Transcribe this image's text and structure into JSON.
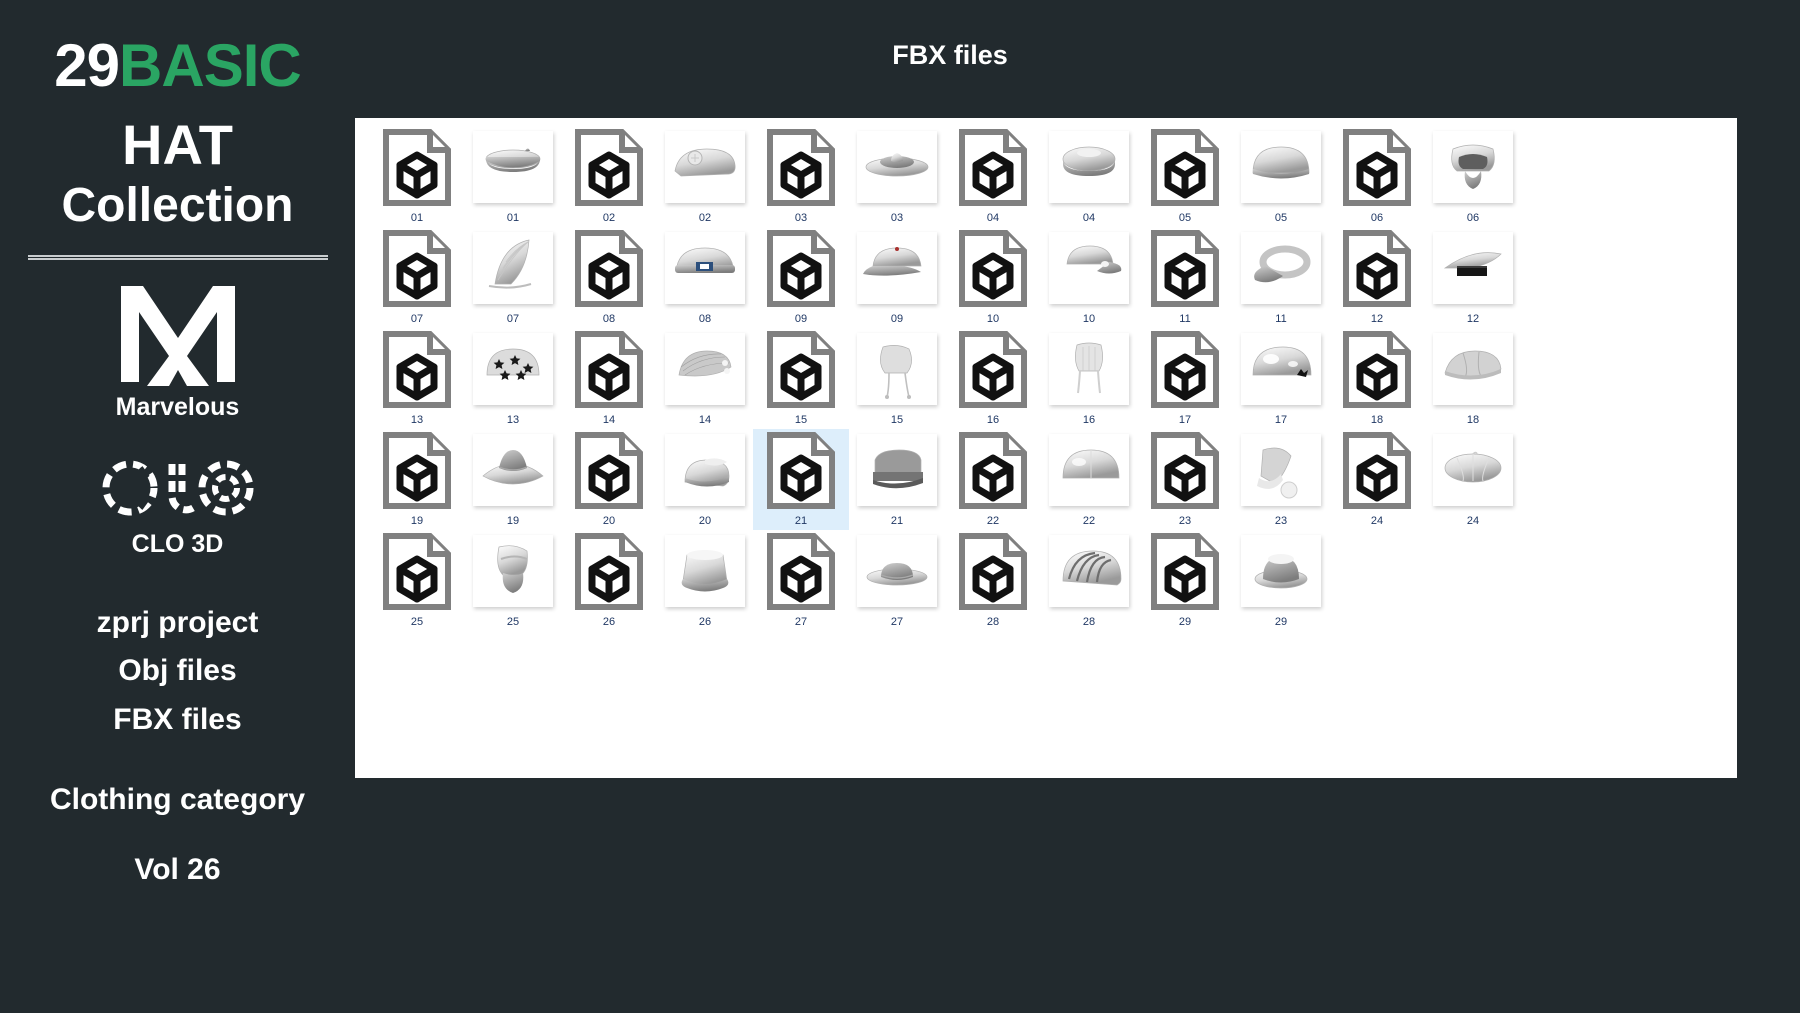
{
  "brand": {
    "count": "29",
    "basic": "BASIC",
    "hat": "HAT",
    "collection": "Collection",
    "marvelous_name": "Marvelous",
    "marvelous_logo_icon": "marvelous-designer-m-logo",
    "clo_name": "CLO 3D",
    "clo_logo_icon": "clo3d-dashed-circles-logo",
    "accent_color": "#2aa563",
    "background_color": "#222a2e",
    "text_color": "#ffffff"
  },
  "files_list": [
    "zprj project",
    "Obj files",
    "FBX files"
  ],
  "category": {
    "label": "Clothing category",
    "volume": "Vol 26"
  },
  "header": {
    "title": "FBX files"
  },
  "panel": {
    "background_color": "#ffffff",
    "selected_index": 21,
    "selection_color": "#ddeefb",
    "label_color": "#203864",
    "file_icon_name": "fbx-3d-cube-file-icon",
    "items": [
      {
        "num": "01",
        "hat": "pillbox-fur-hat"
      },
      {
        "num": "02",
        "hat": "garrison-cap-with-button"
      },
      {
        "num": "03",
        "hat": "flat-wide-brim-hat"
      },
      {
        "num": "04",
        "hat": "baker-boy-cap"
      },
      {
        "num": "05",
        "hat": "beanie-cap"
      },
      {
        "num": "06",
        "hat": "balaclava-hood"
      },
      {
        "num": "07",
        "hat": "pleated-fan-hat"
      },
      {
        "num": "08",
        "hat": "sailor-cap-with-badge"
      },
      {
        "num": "09",
        "hat": "baseball-cap"
      },
      {
        "num": "10",
        "hat": "curved-brim-cap"
      },
      {
        "num": "11",
        "hat": "felt-visor-band"
      },
      {
        "num": "12",
        "hat": "dark-brim-sun-visor"
      },
      {
        "num": "13",
        "hat": "star-print-bandana-cap"
      },
      {
        "num": "14",
        "hat": "textured-flat-cap"
      },
      {
        "num": "15",
        "hat": "hood-with-drawstrings"
      },
      {
        "num": "16",
        "hat": "knit-hat-with-tassels"
      },
      {
        "num": "17",
        "hat": "glossy-helmet-cap"
      },
      {
        "num": "18",
        "hat": "newsboy-felt-cap"
      },
      {
        "num": "19",
        "hat": "wide-brim-floppy-hat"
      },
      {
        "num": "20",
        "hat": "bucket-visor-hat"
      },
      {
        "num": "21",
        "hat": "military-peaked-cap"
      },
      {
        "num": "22",
        "hat": "smooth-skull-cap"
      },
      {
        "num": "23",
        "hat": "santa-pom-pom-hat"
      },
      {
        "num": "24",
        "hat": "white-beret"
      },
      {
        "num": "25",
        "hat": "knit-face-mask-hood"
      },
      {
        "num": "26",
        "hat": "tall-bucket-hat"
      },
      {
        "num": "27",
        "hat": "flat-boater-hat"
      },
      {
        "num": "28",
        "hat": "striped-ridged-helmet"
      },
      {
        "num": "29",
        "hat": "round-crown-hat"
      }
    ]
  }
}
